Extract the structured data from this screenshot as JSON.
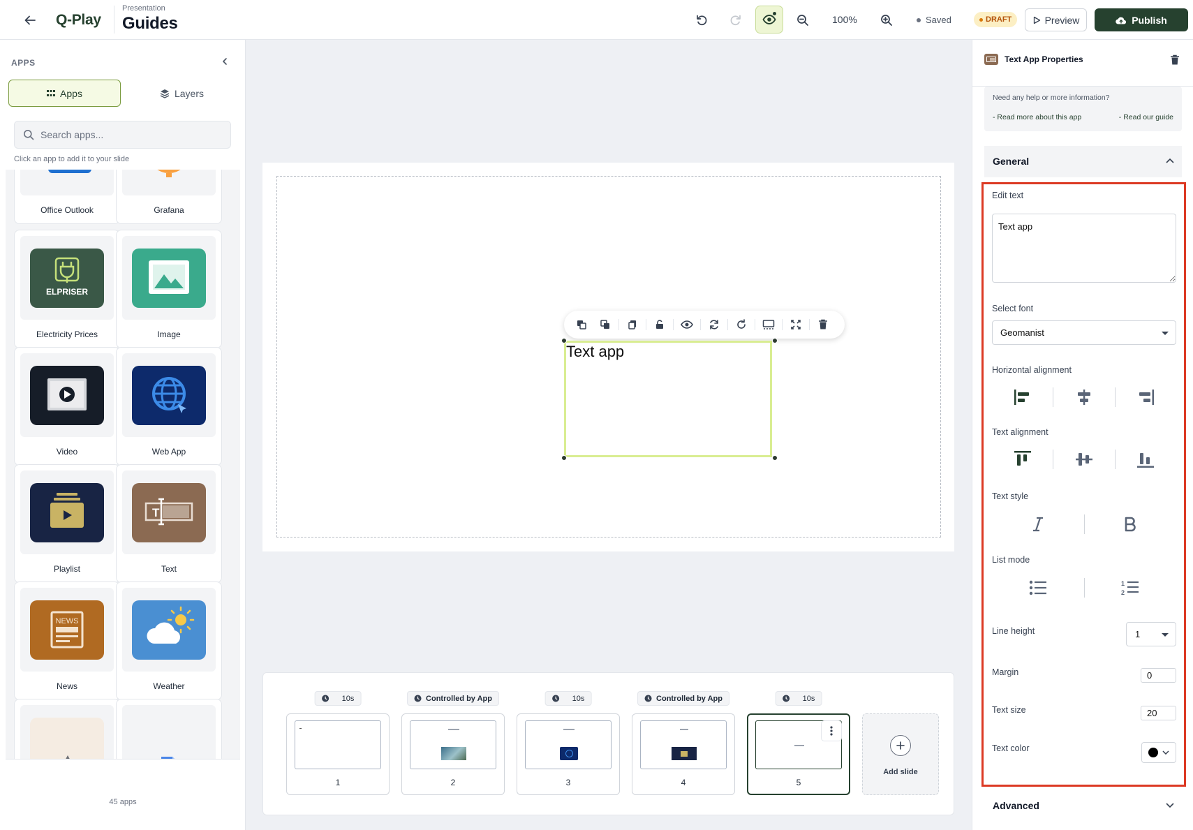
{
  "header": {
    "brand": "Q-Play",
    "crumb": "Presentation",
    "title": "Guides",
    "zoom": "100%",
    "saved": "Saved",
    "draft": "DRAFT",
    "preview_label": "Preview",
    "publish_label": "Publish"
  },
  "sidebar": {
    "title": "APPS",
    "tab_apps": "Apps",
    "tab_layers": "Layers",
    "search_placeholder": "Search apps...",
    "hint": "Click an app to add it to your slide",
    "count": "45 apps",
    "apps": [
      {
        "label": "Office Outlook",
        "icon": "outlook-icon"
      },
      {
        "label": "Grafana",
        "icon": "grafana-icon"
      },
      {
        "label": "Electricity Prices",
        "icon": "plug-icon"
      },
      {
        "label": "Image",
        "icon": "image-icon"
      },
      {
        "label": "Video",
        "icon": "video-icon"
      },
      {
        "label": "Web App",
        "icon": "globe-icon"
      },
      {
        "label": "Playlist",
        "icon": "playlist-icon"
      },
      {
        "label": "Text",
        "icon": "text-icon"
      },
      {
        "label": "News",
        "icon": "news-icon"
      },
      {
        "label": "Weather",
        "icon": "weather-icon"
      }
    ],
    "elpriser_text": "ELPRISER",
    "news_tile_text": "NEWS"
  },
  "canvas": {
    "element_text": "Text app"
  },
  "slides": [
    {
      "duration": "10s",
      "number": "1"
    },
    {
      "duration": "Controlled by App",
      "number": "2"
    },
    {
      "duration": "10s",
      "number": "3"
    },
    {
      "duration": "Controlled by App",
      "number": "4"
    },
    {
      "duration": "10s",
      "number": "5"
    }
  ],
  "add_slide_label": "Add slide",
  "properties": {
    "title": "Text App Properties",
    "help_question": "Need any help or more information?",
    "help_link_app": "- Read more about this app",
    "help_link_guide": "- Read our guide",
    "section_general": "General",
    "edit_text_label": "Edit text",
    "edit_text_value": "Text app",
    "select_font_label": "Select font",
    "font_value": "Geomanist",
    "h_align_label": "Horizontal alignment",
    "text_align_label": "Text alignment",
    "text_style_label": "Text style",
    "list_mode_label": "List mode",
    "line_height_label": "Line height",
    "line_height_value": "1",
    "margin_label": "Margin",
    "margin_value": "0",
    "text_size_label": "Text size",
    "text_size_value": "20",
    "text_color_label": "Text color",
    "text_color_value": "#000000",
    "section_advanced": "Advanced"
  },
  "colors": {
    "brand": "#26412f",
    "accent_lime": "#d9ed92",
    "highlight": "#dc3a24"
  }
}
